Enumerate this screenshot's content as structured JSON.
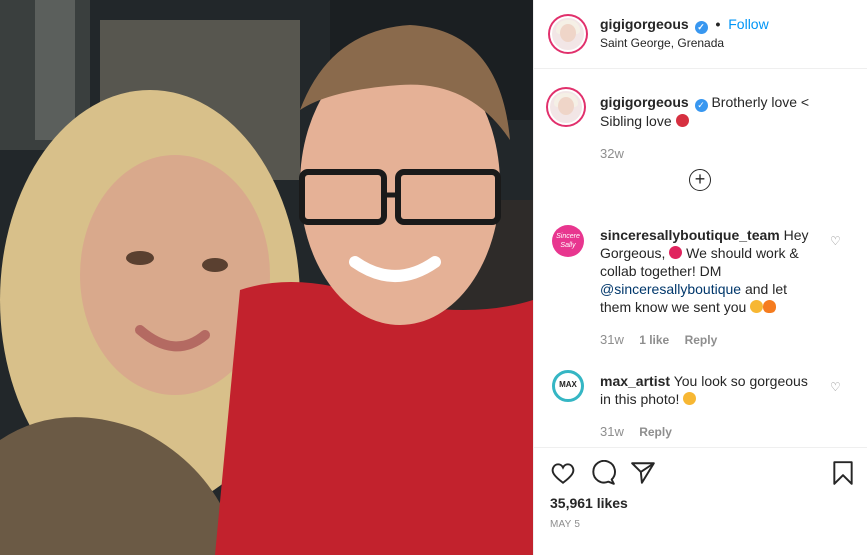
{
  "header": {
    "username": "gigigorgeous",
    "dot": "•",
    "follow_label": "Follow",
    "location": "Saint George, Grenada"
  },
  "caption": {
    "username": "gigigorgeous",
    "text": "Brotherly love <",
    "text2": "Sibling love",
    "time": "32w"
  },
  "comments": [
    {
      "username": "sinceresallyboutique_team",
      "text_a": "Hey Gorgeous,",
      "text_b": "We should work & collab together! DM",
      "mention": "@sinceresallyboutique",
      "text_c": "and let them know we sent you",
      "time": "31w",
      "likes": "1 like",
      "reply": "Reply",
      "avatar_text": "Sincere Sally"
    },
    {
      "username": "max_artist",
      "text_a": "You look so gorgeous in this photo!",
      "time": "31w",
      "reply": "Reply",
      "avatar_text": "MAX"
    }
  ],
  "footer": {
    "likes": "35,961 likes",
    "date": "MAY 5"
  },
  "icons": [
    "heart-icon",
    "comment-icon",
    "share-icon",
    "bookmark-icon",
    "add-comment-icon",
    "verified-icon"
  ],
  "colors": {
    "link": "#0095f6",
    "verified": "#3897f0",
    "muted": "#8e8e8e"
  }
}
